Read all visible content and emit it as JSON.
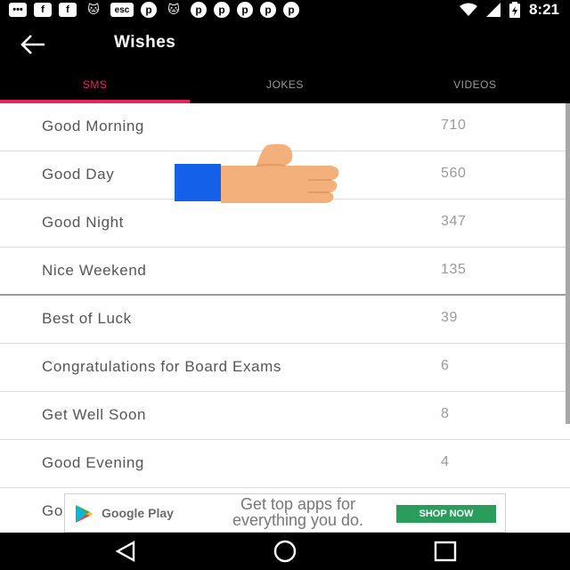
{
  "status_bar": {
    "time": "8:21",
    "icons": [
      "messages-icon",
      "facebook-icon",
      "facebook-icon",
      "cat-icon",
      "esc-icon",
      "pinterest-icon",
      "cat-icon",
      "pinterest-icon",
      "pinterest-icon",
      "pinterest-icon",
      "pinterest-icon",
      "pinterest-icon"
    ],
    "right_icons": [
      "wifi-icon",
      "signal-icon",
      "battery-charging-icon"
    ]
  },
  "appbar": {
    "title": "Wishes"
  },
  "tabs": [
    {
      "label": "SMS",
      "active": true
    },
    {
      "label": "JOKES",
      "active": false
    },
    {
      "label": "VIDEOS",
      "active": false
    }
  ],
  "list": [
    {
      "label": "Good Morning",
      "count": "710"
    },
    {
      "label": "Good Day",
      "count": "560"
    },
    {
      "label": "Good Night",
      "count": "347"
    },
    {
      "label": "Nice Weekend",
      "count": "135"
    },
    {
      "label": "Best of Luck",
      "count": "39"
    },
    {
      "label": "Congratulations for Board Exams",
      "count": "6"
    },
    {
      "label": "Get Well Soon",
      "count": "8"
    },
    {
      "label": "Good Evening",
      "count": "4"
    },
    {
      "label": "Go",
      "count": ""
    }
  ],
  "ad": {
    "brand": "Google Play",
    "text": "Get top apps for everything you do.",
    "button": "SHOP NOW"
  },
  "colors": {
    "accent": "#e8245f",
    "thumb_skin": "#f4b07a",
    "thumb_cuff": "#1560e8",
    "ad_button": "#2a9d5c"
  }
}
